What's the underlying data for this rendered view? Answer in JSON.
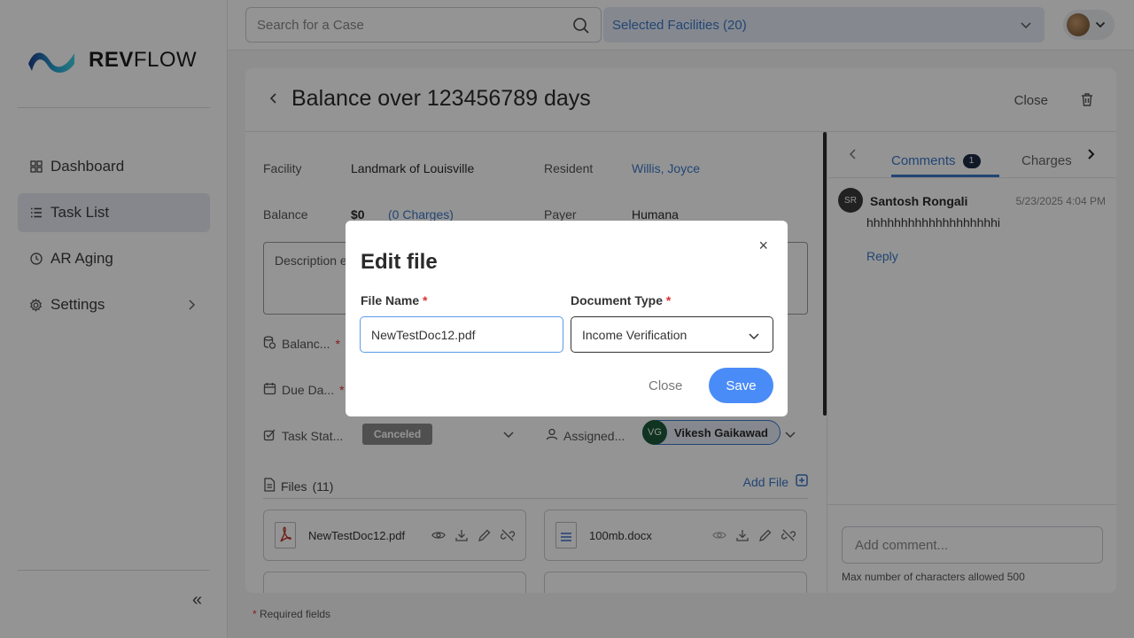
{
  "brand": {
    "name_bold": "REV",
    "name_light": "FLOW"
  },
  "sidebar": {
    "items": [
      {
        "label": "Dashboard",
        "icon": "grid-icon"
      },
      {
        "label": "Task List",
        "icon": "list-icon",
        "active": true
      },
      {
        "label": "AR Aging",
        "icon": "clock-icon"
      },
      {
        "label": "Settings",
        "icon": "gear-icon",
        "has_submenu": true
      }
    ],
    "collapse_label": "«"
  },
  "topbar": {
    "search_placeholder": "Search for a Case",
    "facilities_label": "Selected Facilities (20)"
  },
  "case": {
    "title": "Balance over 123456789 days",
    "close_label": "Close",
    "facility_label": "Facility",
    "facility_value": "Landmark of Louisville",
    "resident_label": "Resident",
    "resident_value": "Willis, Joyce",
    "balance_label": "Balance",
    "balance_value": "$0",
    "charges_link": "(0 Charges)",
    "payer_label": "Payer",
    "payer_value": "Humana",
    "description_placeholder": "Description e",
    "balance_field_label": "Balanc...",
    "due_date_label": "Due Da...",
    "task_status_label": "Task Stat...",
    "task_status_value": "Canceled",
    "assigned_label": "Assigned...",
    "assignee_initials": "VG",
    "assignee_name": "Vikesh Gaikawad",
    "files_label": "Files",
    "files_count": "(11)",
    "add_file_label": "Add File",
    "files": [
      {
        "name": "NewTestDoc12.pdf",
        "type": "pdf"
      },
      {
        "name": "100mb.docx",
        "type": "docx"
      }
    ],
    "required_note": "Required fields"
  },
  "comments_panel": {
    "tabs": [
      {
        "label": "Comments",
        "count": "1",
        "active": true
      },
      {
        "label": "Charges"
      }
    ],
    "comments": [
      {
        "initials": "SR",
        "author": "Santosh Rongali",
        "time": "5/23/2025 4:04 PM",
        "text": "hhhhhhhhhhhhhhhhhhhi",
        "reply_label": "Reply"
      }
    ],
    "input_placeholder": "Add comment...",
    "max_note": "Max number of characters allowed 500"
  },
  "modal": {
    "title": "Edit file",
    "close_icon": "×",
    "file_name_label": "File Name",
    "file_name_value": "NewTestDoc12.pdf",
    "document_type_label": "Document Type",
    "document_type_value": "Income Verification",
    "close_label": "Close",
    "save_label": "Save",
    "required_star": "*"
  },
  "colors": {
    "accent": "#4a8cf7",
    "link": "#3b78c9",
    "required": "#dd3333",
    "badge_canceled": "#8a8a8a"
  }
}
